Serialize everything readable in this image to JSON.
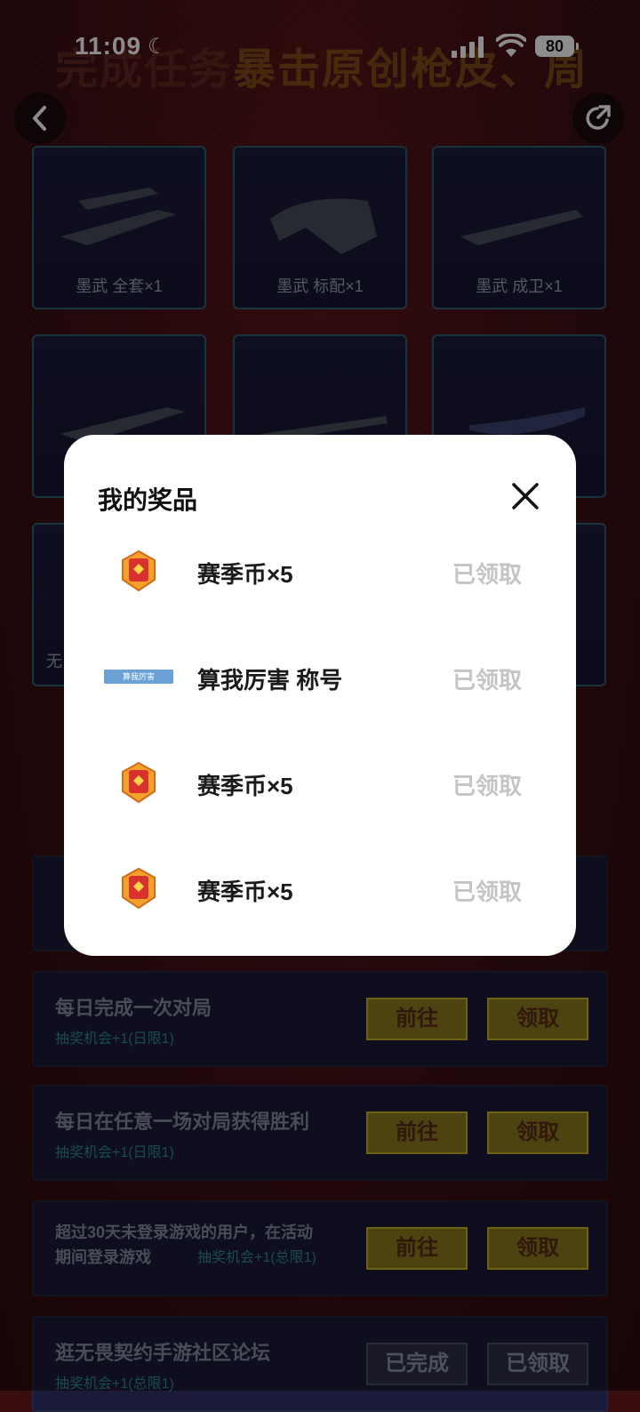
{
  "status_bar": {
    "time": "11:09",
    "battery": "80"
  },
  "banner": {
    "part1": "完成任务",
    "part2": "暴击原创枪皮、周边"
  },
  "rewards": [
    {
      "label": "墨武 全套×1"
    },
    {
      "label": "墨武 标配×1"
    },
    {
      "label": "墨武 成卫×1"
    },
    {
      "label": ""
    },
    {
      "label": ""
    },
    {
      "label": ""
    },
    {
      "label": "无"
    }
  ],
  "tasks": [
    {
      "title": "每日完成一次对局",
      "sub": "抽奖机会+1(日限1)",
      "go": "前往",
      "claim": "领取"
    },
    {
      "title": "每日在任意一场对局获得胜利",
      "sub": "抽奖机会+1(日限1)",
      "go": "前往",
      "claim": "领取"
    },
    {
      "title": "超过30天未登录游戏的用户，在活动",
      "title2": "期间登录游戏",
      "sub": "抽奖机会+1(总限1)",
      "go": "前往",
      "claim": "领取"
    },
    {
      "title": "逛无畏契约手游社区论坛",
      "sub": "抽奖机会+1(总限1)",
      "go": "已完成",
      "claim": "已领取"
    }
  ],
  "modal": {
    "title": "我的奖品",
    "items": [
      {
        "name": "赛季币×5",
        "status": "已领取",
        "icon": "season-coin-icon"
      },
      {
        "name": "算我厉害 称号",
        "status": "已领取",
        "icon": "title-badge",
        "badge_text": "算我厉害"
      },
      {
        "name": "赛季币×5",
        "status": "已领取",
        "icon": "season-coin-icon"
      },
      {
        "name": "赛季币×5",
        "status": "已领取",
        "icon": "season-coin-icon"
      }
    ]
  }
}
